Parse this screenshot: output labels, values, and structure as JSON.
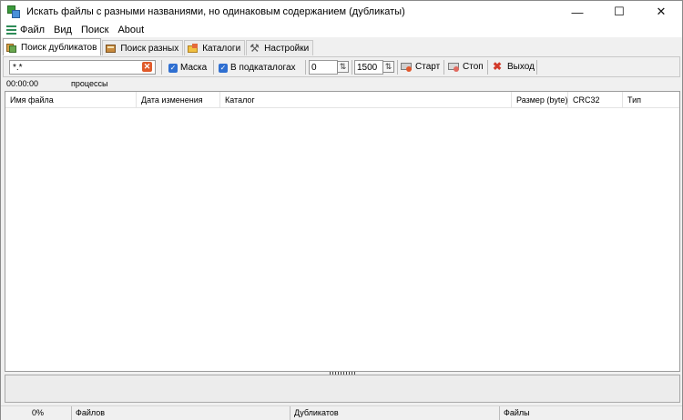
{
  "window": {
    "title": "Искать файлы с разными названиями, но одинаковым содержанием (дубликаты)",
    "controls": {
      "minimize": "—",
      "maximize": "☐",
      "close": "✕"
    }
  },
  "menu": {
    "items": [
      "Файл",
      "Вид",
      "Поиск",
      "About"
    ]
  },
  "tabs": [
    {
      "label": "Поиск дубликатов",
      "active": true,
      "icon": "duplicates-icon"
    },
    {
      "label": "Поиск разных",
      "active": false,
      "icon": "different-files-icon"
    },
    {
      "label": "Каталоги",
      "active": false,
      "icon": "folders-icon"
    },
    {
      "label": "Настройки",
      "active": false,
      "icon": "tools-icon"
    }
  ],
  "toolbar": {
    "mask_value": "*.*",
    "mask_check": {
      "label": "Маска",
      "checked": true
    },
    "subdirs_check": {
      "label": "В подкаталогах",
      "checked": true
    },
    "min_size": "0",
    "max_size": "1500",
    "start_label": "Старт",
    "stop_label": "Стоп",
    "exit_label": "Выход"
  },
  "status_line": {
    "time": "00:00:00",
    "process_label": "процессы"
  },
  "grid": {
    "columns": [
      "Имя файла",
      "Дата изменения",
      "Каталог",
      "Размер (byte)",
      "CRC32",
      "Тип"
    ]
  },
  "statusbar": {
    "percent": "0%",
    "files_label": "Файлов",
    "duplicates_label": "Дубликатов",
    "files2_label": "Файлы"
  }
}
